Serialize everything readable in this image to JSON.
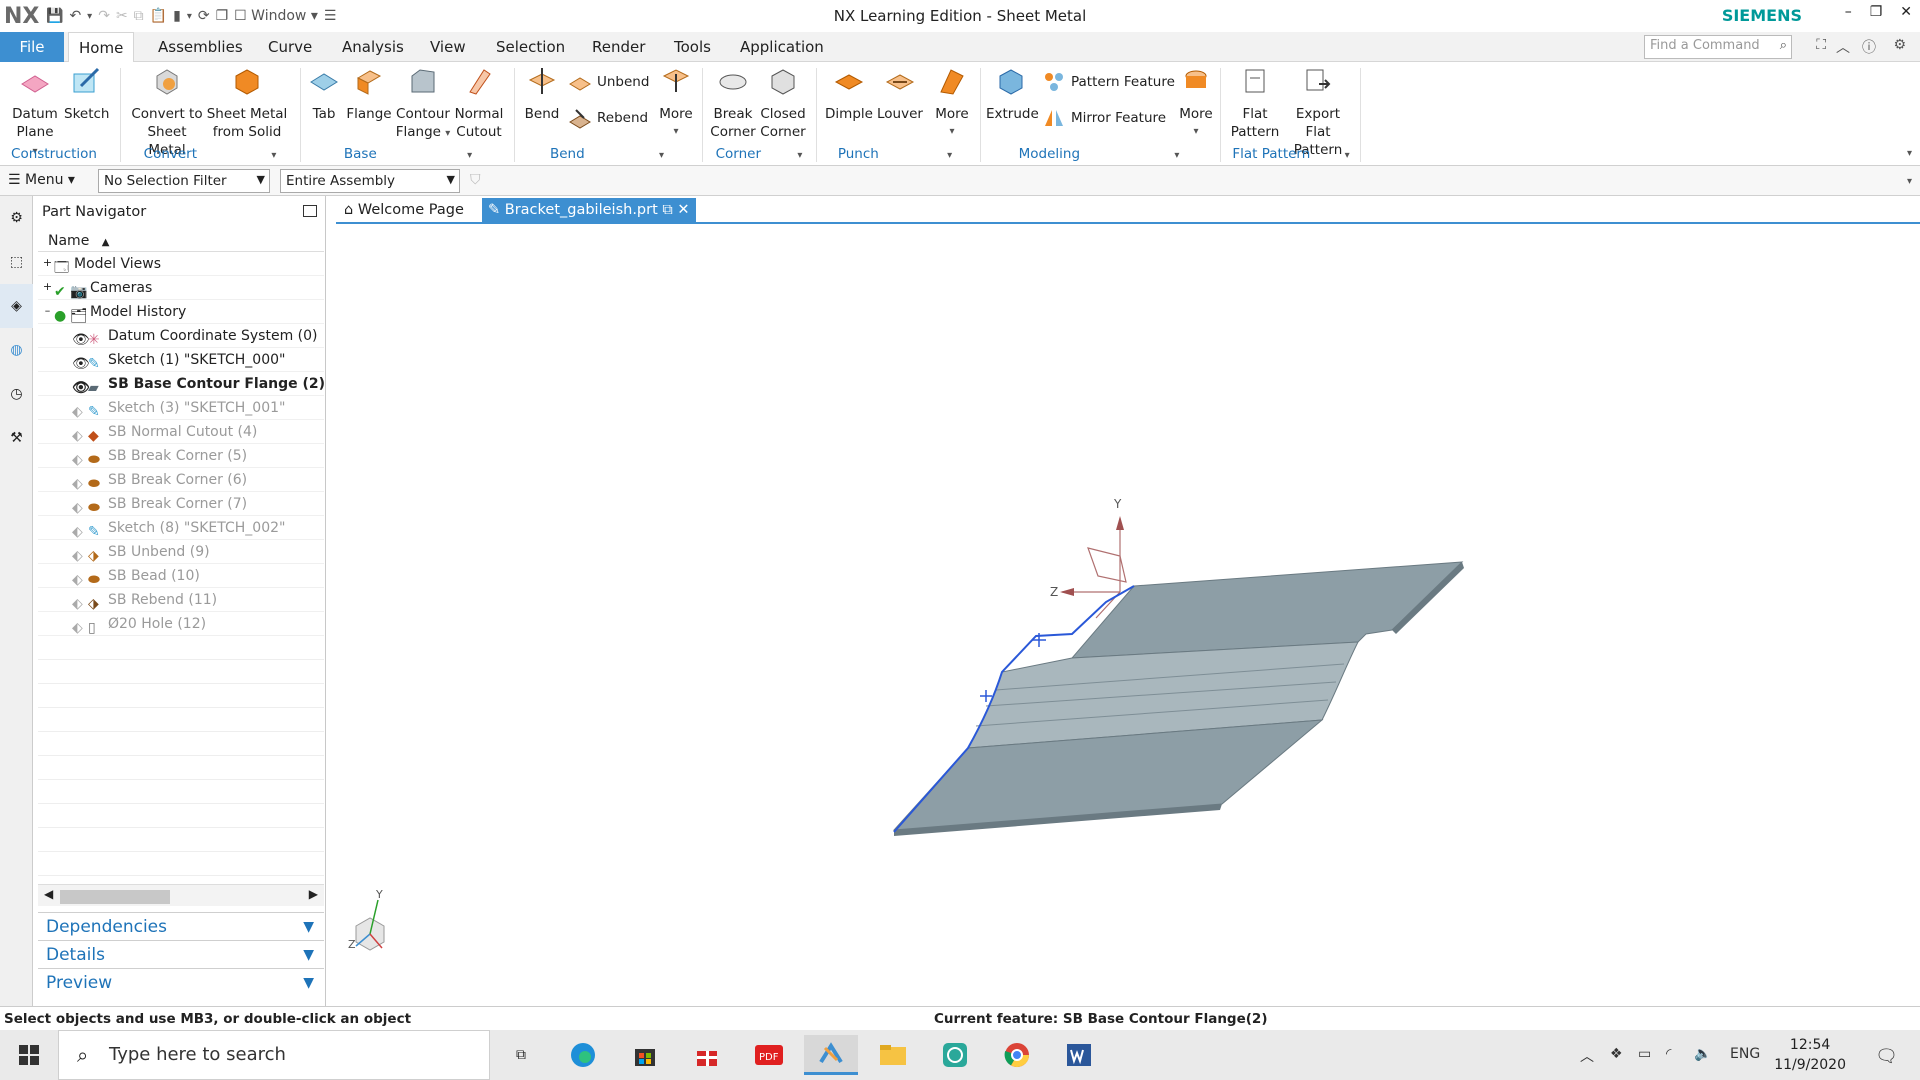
{
  "app": {
    "logo": "NX",
    "title": "NX Learning Edition - Sheet Metal",
    "brand": "SIEMENS",
    "window_label": "Window"
  },
  "menu_tabs": [
    {
      "label": "File"
    },
    {
      "label": "Home"
    },
    {
      "label": "Assemblies"
    },
    {
      "label": "Curve"
    },
    {
      "label": "Analysis"
    },
    {
      "label": "View"
    },
    {
      "label": "Selection"
    },
    {
      "label": "Render"
    },
    {
      "label": "Tools"
    },
    {
      "label": "Application"
    }
  ],
  "find_command": {
    "placeholder": "Find a Command"
  },
  "ribbon": {
    "datum_plane": [
      "Datum",
      "Plane"
    ],
    "sketch": "Sketch",
    "construction": "Construction",
    "convert_to_sm": [
      "Convert to",
      "Sheet Metal"
    ],
    "sm_from_solid": [
      "Sheet Metal",
      "from Solid"
    ],
    "convert": "Convert",
    "tab": "Tab",
    "flange": "Flange",
    "contour_flange": [
      "Contour",
      "Flange"
    ],
    "normal_cutout": [
      "Normal",
      "Cutout"
    ],
    "base": "Base",
    "bend": "Bend",
    "unbend": "Unbend",
    "rebend": "Rebend",
    "more": "More",
    "bend_group": "Bend",
    "break_corner": [
      "Break",
      "Corner"
    ],
    "closed_corner": [
      "Closed",
      "Corner"
    ],
    "corner": "Corner",
    "dimple": "Dimple",
    "louver": "Louver",
    "punch": "Punch",
    "extrude": "Extrude",
    "pattern_feature": "Pattern Feature",
    "mirror_feature": "Mirror Feature",
    "modeling": "Modeling",
    "flat_pattern": [
      "Flat",
      "Pattern"
    ],
    "export_flat_pattern": [
      "Export Flat",
      "Pattern"
    ],
    "flat_pattern_group": "Flat Pattern"
  },
  "selection_bar": {
    "menu": "Menu",
    "filter": "No Selection Filter",
    "scope": "Entire Assembly"
  },
  "part_navigator": {
    "title": "Part Navigator",
    "column_name": "Name",
    "nodes": [
      {
        "label": "Model Views"
      },
      {
        "label": "Cameras"
      },
      {
        "label": "Model History"
      },
      {
        "label": "Datum Coordinate System (0)"
      },
      {
        "label": "Sketch (1) \"SKETCH_000\""
      },
      {
        "label": "SB Base Contour Flange (2)"
      },
      {
        "label": "Sketch (3) \"SKETCH_001\""
      },
      {
        "label": "SB Normal Cutout (4)"
      },
      {
        "label": "SB Break Corner (5)"
      },
      {
        "label": "SB Break Corner (6)"
      },
      {
        "label": "SB Break Corner (7)"
      },
      {
        "label": "Sketch (8) \"SKETCH_002\""
      },
      {
        "label": "SB Unbend (9)"
      },
      {
        "label": "SB Bead (10)"
      },
      {
        "label": "SB Rebend (11)"
      },
      {
        "label": "Ø20 Hole (12)"
      }
    ],
    "panels": [
      {
        "label": "Dependencies"
      },
      {
        "label": "Details"
      },
      {
        "label": "Preview"
      }
    ]
  },
  "doc_tabs": [
    {
      "label": "Welcome Page"
    },
    {
      "label": "Bracket_gabileish.prt"
    }
  ],
  "viewport": {
    "axis_y": "Y",
    "axis_z": "Z",
    "mini_y": "Y",
    "mini_z": "Z"
  },
  "status": {
    "prompt": "Select objects and use MB3, or double-click an object",
    "current_feature": "Current feature: SB Base Contour Flange(2)"
  },
  "taskbar": {
    "search_placeholder": "Type here to search",
    "language": "ENG",
    "time": "12:54",
    "date": "11/9/2020",
    "pdf_label": "PDF"
  },
  "colors": {
    "accent": "#3d8fd1",
    "brand": "#009999",
    "part": "#8d9ea6"
  }
}
